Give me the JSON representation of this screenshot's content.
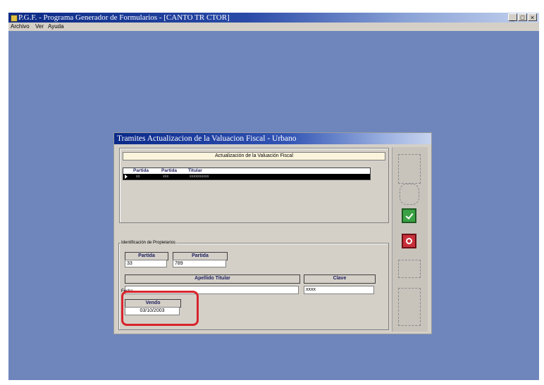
{
  "app": {
    "title": "P.G.F. - Programa Generador de Formularios - [CANTO TR CTOR]",
    "menu": [
      "Archivo",
      "Ver",
      "Ayuda"
    ],
    "window_buttons": [
      "_",
      "□",
      "×"
    ]
  },
  "dialog": {
    "title": "Tramites  Actualizacion de la Valuacion Fiscal - Urbano",
    "header": "Actualización de la Valuación Fiscal",
    "grid": {
      "columns": [
        "Partida",
        "Partida",
        "Titular"
      ],
      "row": [
        "xx",
        "xxx",
        "xxxxxxxxxx"
      ]
    },
    "group_label": "Identificación de Propietarios",
    "partida1": {
      "label": "Partida",
      "value": "33"
    },
    "partida2": {
      "label": "Partida",
      "value": "789"
    },
    "apellido": {
      "label": "Apellido Titular",
      "value": ""
    },
    "clave": {
      "label": "Clave",
      "value": "xxxx"
    },
    "vendo": {
      "label": "Vendo",
      "value": "03/10/2003"
    },
    "section_label": "Fecha"
  },
  "colors": {
    "desktop": "#6f86bd",
    "accept": "#3aa245",
    "cancel": "#c8303a",
    "highlight": "#d8242c"
  }
}
